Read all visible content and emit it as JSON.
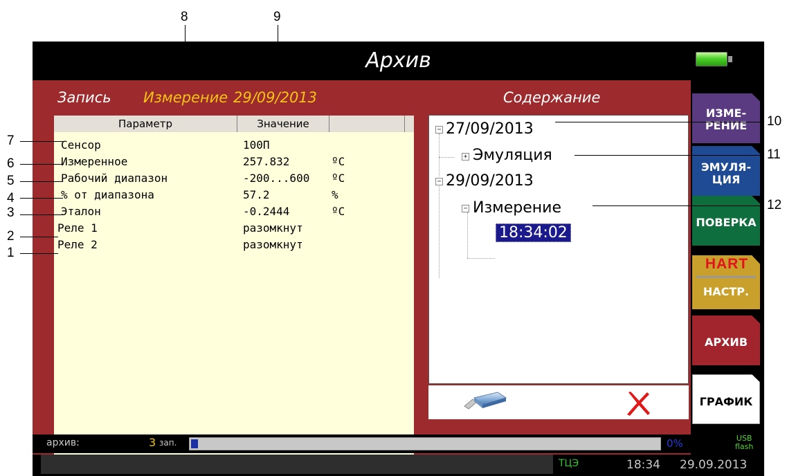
{
  "screen": {
    "title": "Архив"
  },
  "header": {
    "record_label": "Запись",
    "record_type": "Измерение",
    "record_date": "29/09/2013",
    "content_label": "Содержание"
  },
  "table": {
    "columns": [
      "Параметр",
      "Значение",
      ""
    ],
    "rows": [
      {
        "name": "Сенсор",
        "value": "100П",
        "unit": ""
      },
      {
        "name": "Измеренное",
        "value": "257.832",
        "unit": "ºC"
      },
      {
        "name": "Рабочий диапазон",
        "value": "-200...600",
        "unit": "ºC"
      },
      {
        "name": "% от диапазона",
        "value": "57.2",
        "unit": "%"
      },
      {
        "name": "Эталон",
        "value": "-0.2444",
        "unit": "ºC"
      },
      {
        "name": "Реле 1",
        "value": "разомкнут",
        "unit": ""
      },
      {
        "name": "Реле 2",
        "value": "разомкнут",
        "unit": ""
      }
    ]
  },
  "tree": {
    "date1": "27/09/2013",
    "date1_child": "Эмуляция",
    "date2": "29/09/2013",
    "date2_child": "Измерение",
    "time": "18:34:02",
    "expander_minus": "−",
    "expander_plus": "+"
  },
  "tabs": {
    "measure": [
      "ИЗМЕ-",
      "РЕНИЕ"
    ],
    "emulation": [
      "ЭМУЛЯ-",
      "ЦИЯ"
    ],
    "verification": "ПОВЕРКА",
    "hart_logo": "HART",
    "hart_settings": "НАСТР.",
    "archive": "АРХИВ",
    "graph": "ГРАФИК"
  },
  "status": {
    "archive_label": "архив:",
    "record_count": "3",
    "record_unit": "зап.",
    "fill_percent": 1,
    "percent_text": "0%",
    "usb_top": "USB",
    "usb_bottom": "flash",
    "mode": "ТЦЭ",
    "time": "18:34",
    "date": "29.09.2013"
  },
  "callouts": [
    "1",
    "2",
    "3",
    "4",
    "5",
    "6",
    "7",
    "8",
    "9",
    "10",
    "11",
    "12"
  ],
  "colors": {
    "panel_bg": "#9d2a2c",
    "accent_yellow": "#f2c318",
    "tab_measure": "#5a3a80",
    "tab_emulation": "#1e4b93",
    "tab_verification": "#0e6e3d",
    "tab_hart": "#c8a02b",
    "tab_archive": "#a2252d",
    "progress_fill": "#1b2ea3"
  }
}
